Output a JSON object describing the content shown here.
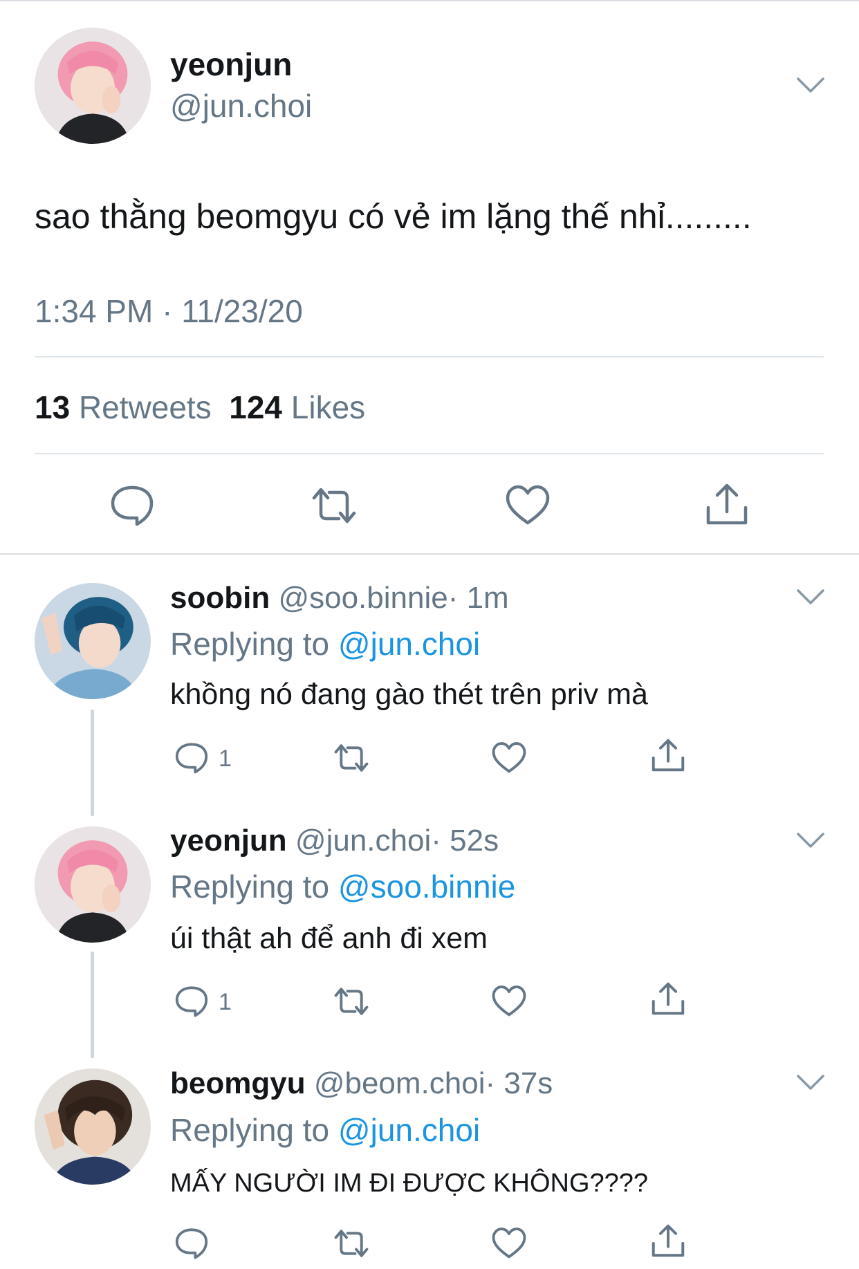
{
  "main_tweet": {
    "display_name": "yeonjun",
    "handle": "@jun.choi",
    "text": "sao thằng beomgyu có vẻ im lặng thế nhỉ.........",
    "timestamp": "1:34 PM · 11/23/20",
    "retweets_count": "13",
    "retweets_label": "Retweets",
    "likes_count": "124",
    "likes_label": "Likes"
  },
  "replies": [
    {
      "display_name": "soobin",
      "handle": "@soo.binnie",
      "time": "· 1m",
      "replying_prefix": "Replying to",
      "replying_to": "@jun.choi",
      "text": "khồng nó đang gào thét trên priv mà",
      "reply_count": "1"
    },
    {
      "display_name": "yeonjun",
      "handle": "@jun.choi",
      "time": "· 52s",
      "replying_prefix": "Replying to",
      "replying_to": "@soo.binnie",
      "text": "úi thật ah để anh đi xem",
      "reply_count": "1"
    },
    {
      "display_name": "beomgyu",
      "handle": "@beom.choi",
      "time": "· 37s",
      "replying_prefix": "Replying to",
      "replying_to": "@jun.choi",
      "text": "MẤY NGƯỜI IM ĐI ĐƯỢC KHÔNG????",
      "reply_count": ""
    }
  ],
  "icons": {
    "reply": "reply-icon",
    "retweet": "retweet-icon",
    "like": "heart-icon",
    "share": "share-icon",
    "more": "chevron-down-icon"
  },
  "colors": {
    "link": "#1b95e0",
    "secondary_text": "#657786",
    "icon": "#657786",
    "divider": "#e1e8ed"
  }
}
